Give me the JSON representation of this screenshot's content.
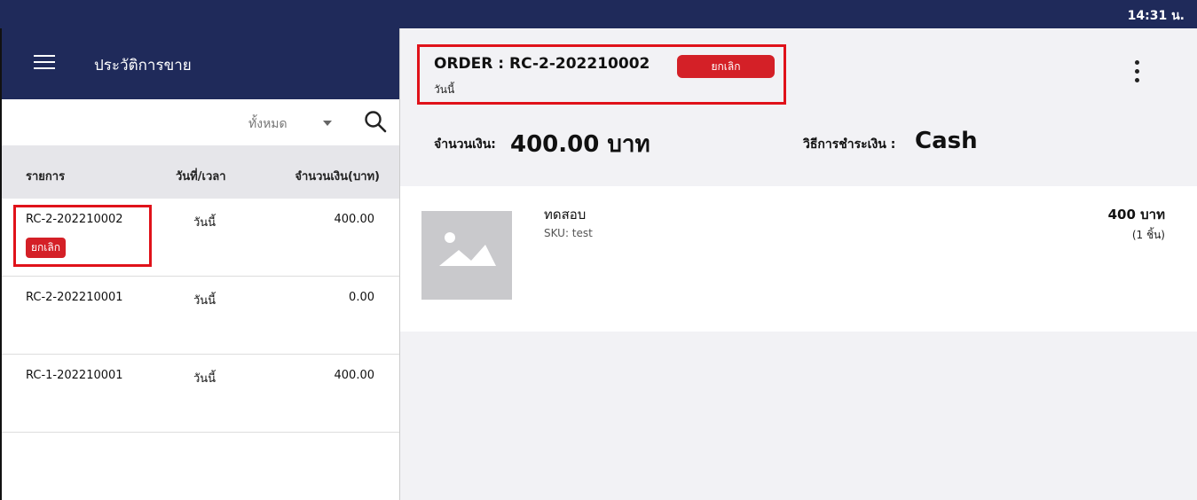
{
  "status_bar": {
    "time": "14:31 น."
  },
  "sidebar": {
    "title": "ประวัติการขาย",
    "filter": {
      "selected": "ทั้งหมด"
    },
    "table": {
      "headers": {
        "item": "รายการ",
        "date": "วันที่/เวลา",
        "amount": "จำนวนเงิน(บาท)"
      },
      "rows": [
        {
          "id": "RC-2-202210002",
          "date": "วันนี้",
          "amount": "400.00",
          "badge": "ยกเลิก"
        },
        {
          "id": "RC-2-202210001",
          "date": "วันนี้",
          "amount": "0.00"
        },
        {
          "id": "RC-1-202210001",
          "date": "วันนี้",
          "amount": "400.00"
        }
      ]
    }
  },
  "order": {
    "title": "ORDER : RC-2-202210002",
    "status_badge": "ยกเลิก",
    "date": "วันนี้",
    "amount_label": "จำนวนเงิน:",
    "amount_value": "400.00 บาท",
    "payment_label": "วิธีการชำระเงิน :",
    "payment_value": "Cash",
    "items": [
      {
        "name": "ทดสอบ",
        "sku": "SKU: test",
        "price": "400 บาท",
        "qty": "(1 ชิ้น)"
      }
    ]
  },
  "colors": {
    "header": "#1f2a5a",
    "badge": "#d42027",
    "highlight": "#e0121a"
  }
}
